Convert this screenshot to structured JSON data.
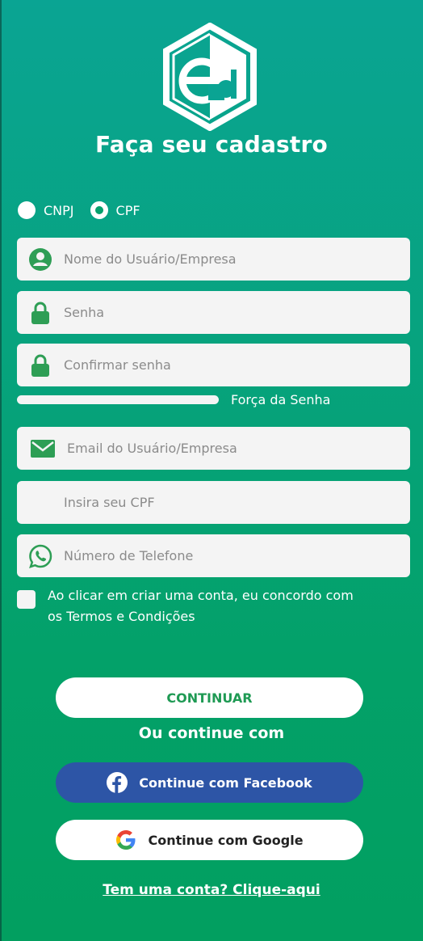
{
  "title": "Faça seu cadastro",
  "document_type": {
    "options": [
      {
        "label": "CNPJ",
        "selected": false
      },
      {
        "label": "CPF",
        "selected": true
      }
    ]
  },
  "fields": {
    "username": {
      "placeholder": "Nome do Usuário/Empresa",
      "icon": "user-icon"
    },
    "password": {
      "placeholder": "Senha",
      "icon": "lock-icon"
    },
    "confirm_password": {
      "placeholder": "Confirmar senha",
      "icon": "lock-icon"
    },
    "email": {
      "placeholder": "Email do Usuário/Empresa",
      "icon": "mail-icon"
    },
    "cpf": {
      "placeholder": "Insira seu CPF"
    },
    "phone": {
      "placeholder": "Número de Telefone",
      "icon": "whatsapp-icon"
    }
  },
  "password_strength": {
    "label": "Força da Senha",
    "level": 0
  },
  "terms": {
    "checked": false,
    "text": "Ao clicar em criar uma conta, eu concordo com os Termos e Condições"
  },
  "buttons": {
    "continue": "CONTINUAR",
    "or_text": "Ou continue com",
    "facebook": "Continue com Facebook",
    "google": "Continue com Google"
  },
  "login_link": "Tem uma conta? Clique-aqui",
  "colors": {
    "accent_green": "#2e9e55",
    "facebook_blue": "#2d55a6",
    "field_bg": "#f4f4f4"
  }
}
